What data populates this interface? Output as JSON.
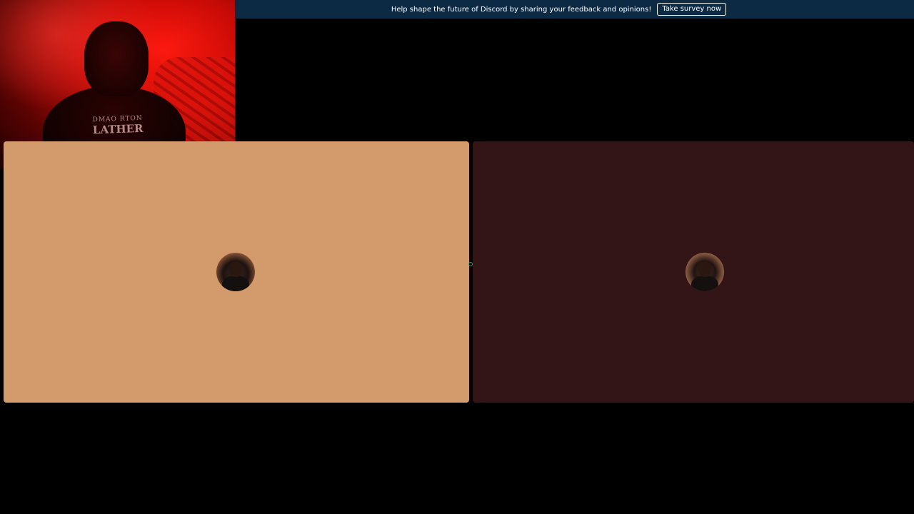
{
  "notice": {
    "message": "Help shape the future of Discord by sharing your feedback and opinions!",
    "button_label": "Take survey now"
  },
  "webcam": {
    "shirt_line1": "DMAO RTON",
    "shirt_line2": "LATHER"
  },
  "participants": [
    {
      "avatar_icon": "user-avatar-icon",
      "tile_color": "#d39a6b"
    },
    {
      "avatar_icon": "user-avatar-icon",
      "tile_color": "#331518"
    }
  ],
  "colors": {
    "background": "#000000",
    "notice_bar": "#0c2a44",
    "resize_handle": "#3ba55d"
  }
}
